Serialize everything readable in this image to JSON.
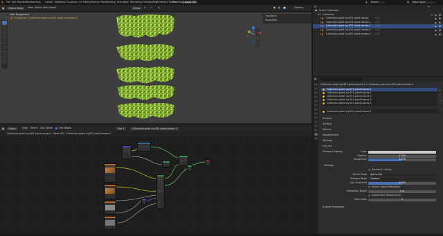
{
  "topbar": {
    "menus": [
      "File",
      "Edit",
      "Render",
      "Window",
      "Help"
    ],
    "workspaces": [
      "Layout",
      "Modeling",
      "Sculpting",
      "UV Editing",
      "Texture Paint",
      "Shading",
      "Animation",
      "Rendering",
      "Compositing",
      "Geometry Nodes",
      "Scripting",
      "Layout.001"
    ],
    "scene": "Scene",
    "view_layer": "View Layer"
  },
  "viewport": {
    "mode": "Object Mode",
    "menus": [
      "View",
      "Select",
      "Add",
      "Object"
    ],
    "transform": "Global",
    "title": "User Perspective",
    "subtitle": "(17) Collection | Collection.plant.ivy.001.plant.ivy.leaves.2",
    "npanel_items": [
      "Transform",
      "Properties"
    ],
    "options": "Options"
  },
  "node_editor": {
    "editor_type": "Object",
    "menus": [
      "View",
      "Select",
      "Add",
      "Node"
    ],
    "use_nodes": "Use Nodes",
    "slot": "Slot 1",
    "material": "Collection.plant.ivy.001.plant.leaves.1",
    "breadcrumb": [
      "Collection.plant.ivy.001.plant.leaves.2",
      "Mesh.002",
      "Collection.plant.ivy.001.plant.leaves.1"
    ]
  },
  "outliner": {
    "title": "Scene Collection",
    "rows": [
      "Collection",
      "Collection.plant.ivy.001.plant.leaves",
      "Collection.plant.ivy.001.plant.leaves.1",
      "Collection.plant.ivy.001.plant.leaves.2",
      "Collection.plant.ivy.001.plant.leaves.3",
      "Collection.plant.ivy.001.plant.leaves.4"
    ]
  },
  "properties": {
    "breadcrumb": "Collection.plant.ivy.001.plant.leaves.2 > Collection.plant.ivy.001.plant.leaves.1",
    "slots": [
      "Collection.plant.ivy.001.plant.leaves.1",
      "Collection.plant.ivy.001.plant.leaves.2",
      "Collection.plant.ivy.001.plant.leaves.3",
      "Collection.plant.ivy.001.plant.leaves.4",
      "Collection.plant.ivy.001.plant.leaves.5"
    ],
    "material_name": "Collection.plant.ivy.001.plant.leaves.1",
    "panels": [
      "Preview",
      "Surface",
      "Volume",
      "Displacement",
      "Settings",
      "Line Art",
      "Viewport Display"
    ],
    "viewport_display": {
      "color_label": "Color",
      "metallic_label": "Metallic",
      "metallic": "0.000",
      "roughness_label": "Roughness",
      "roughness": "0.500"
    },
    "settings_title": "Settings",
    "settings": {
      "backface": "Backface Culling",
      "blend_mode_label": "Blend Mode",
      "blend_mode": "Alpha Clip",
      "shadow_mode_label": "Shadow Mode",
      "shadow_mode": "Opaque",
      "clip_label": "Clip Threshold",
      "clip": "0.500",
      "ssr": "Screen Space Refraction",
      "refr_label": "Refraction Depth",
      "refr": "0 m",
      "sss": "Subsurface Translucency",
      "pass_label": "Pass Index",
      "pass": "0"
    },
    "custom": "Custom Properties"
  },
  "colors": {
    "accent": "#4772b3",
    "ivy": "#8fb83a",
    "node_shader": "#3c8d5f",
    "node_texture": "#b5652c",
    "node_vector": "#4a4ab0"
  }
}
